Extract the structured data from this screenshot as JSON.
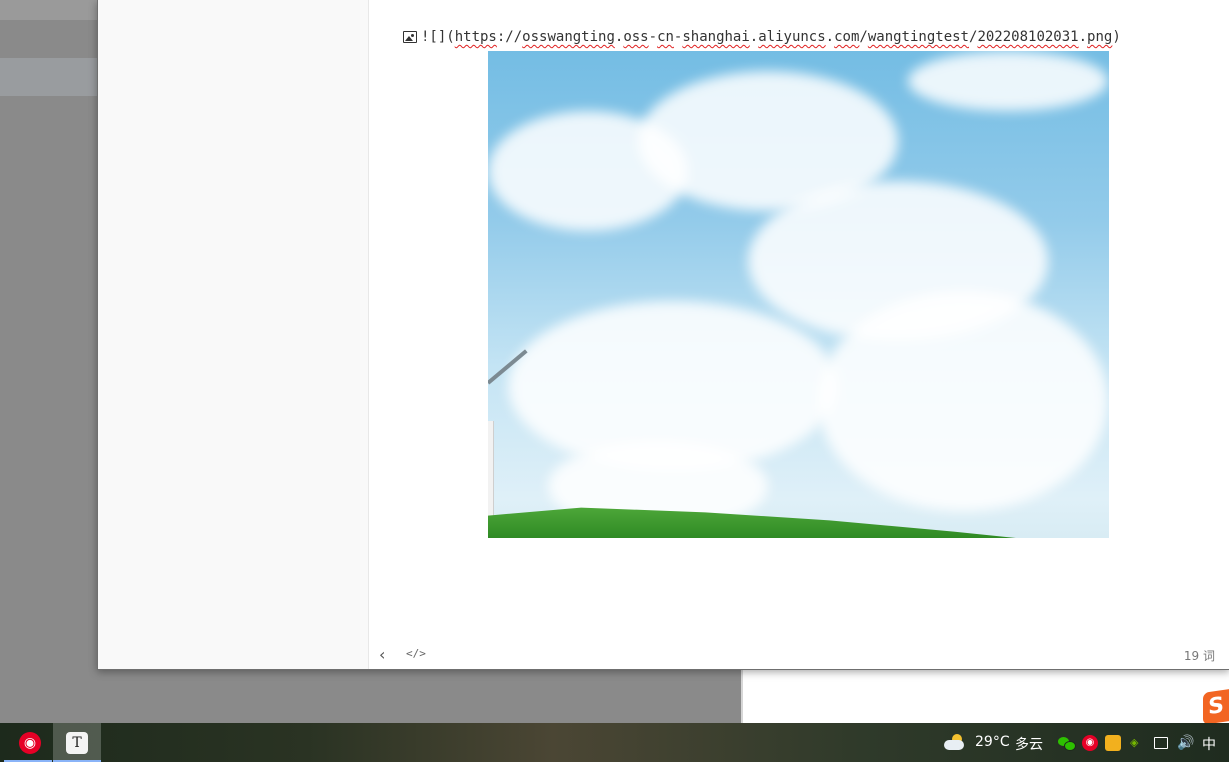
{
  "editor": {
    "markdown_prefix": "![](",
    "url_parts": [
      "https",
      "://",
      "osswangting",
      ".",
      "oss",
      "-",
      "cn",
      "-",
      "shanghai",
      ".",
      "aliyuncs",
      ".",
      "com",
      "/",
      "wangtingtest",
      "/",
      "202208102031",
      ".",
      "png"
    ],
    "markdown_suffix": ")"
  },
  "statusbar": {
    "back_glyph": "‹",
    "source_glyph": "</>",
    "word_count": "19 词"
  },
  "taskbar": {
    "temperature": "29°C",
    "weather_condition": "多云",
    "ime_mode": "中",
    "netease_glyph": "◉",
    "typora_glyph": "T",
    "nvidia_glyph": "◈",
    "volume_glyph": "🔊"
  },
  "sogou_glyph": "S"
}
